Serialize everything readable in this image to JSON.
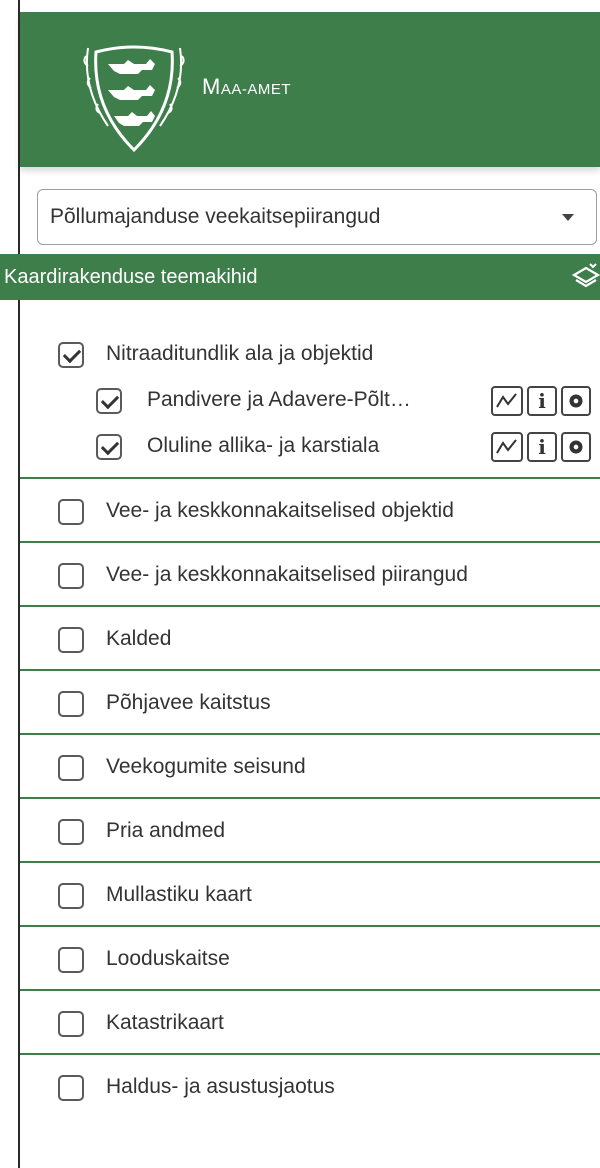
{
  "colors": {
    "green": "#3d7e4a"
  },
  "header": {
    "org_name_cap": "M",
    "org_name_rest": "AA-AMET"
  },
  "theme_select": {
    "value": "Põllumajanduse veekaitsepiirangud"
  },
  "section": {
    "title": "Kaardirakenduse teemakihid",
    "icon": "layers-icon"
  },
  "groups": {
    "first": {
      "label": "Nitraaditundlik ala ja objektid",
      "checked": true,
      "children": [
        {
          "label": "Pandivere ja Adavere-Põlt…",
          "checked": true
        },
        {
          "label": "Oluline allika- ja karstiala",
          "checked": true
        }
      ]
    },
    "items": [
      "Vee- ja keskkonnakaitselised objektid",
      "Vee- ja keskkonnakaitselised piirangud",
      "Kalded",
      "Põhjavee kaitstus",
      "Veekogumite seisund",
      "Pria andmed",
      "Mullastiku kaart",
      "Looduskaitse",
      "Katastrikaart",
      "Haldus- ja asustusjaotus"
    ]
  },
  "tools": {
    "legend_icon": "legend-icon",
    "info_glyph": "i",
    "settings_icon": "gear-icon"
  }
}
